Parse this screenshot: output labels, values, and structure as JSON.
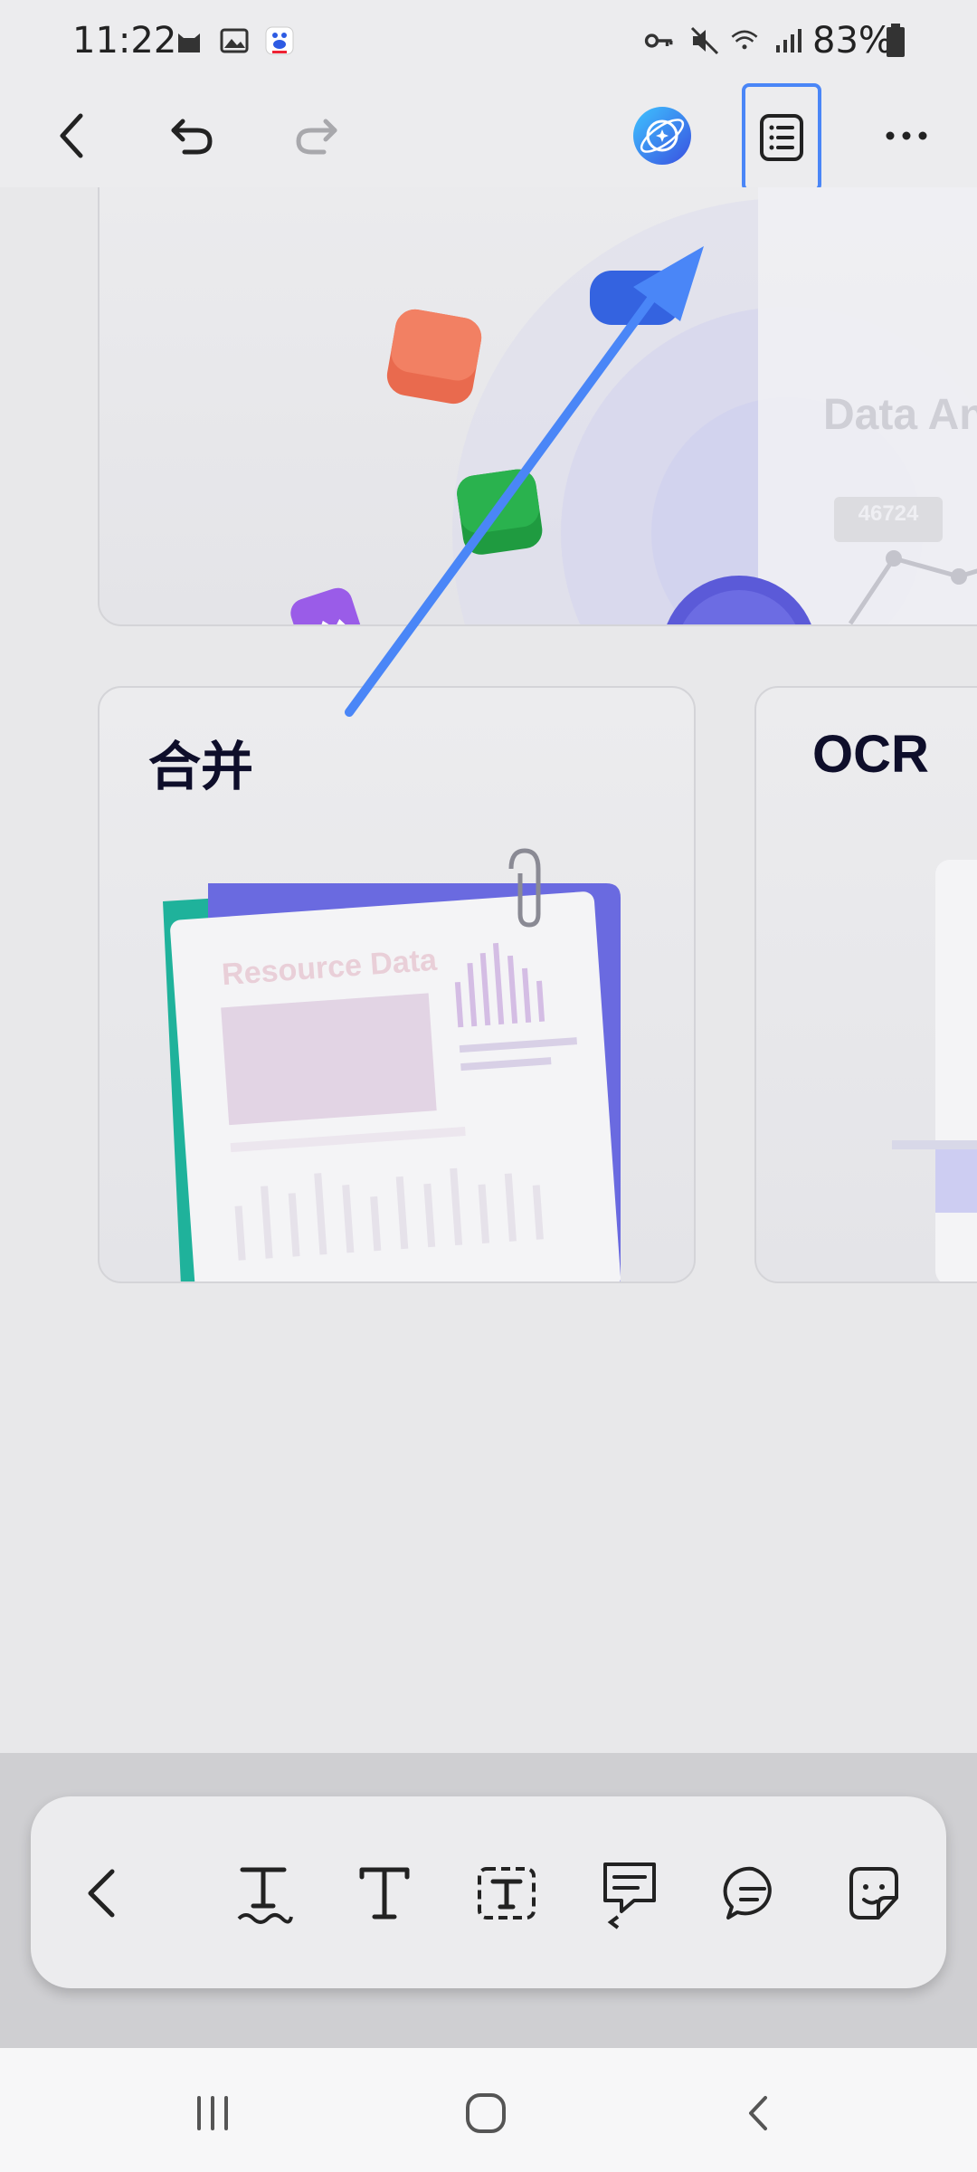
{
  "status_bar": {
    "time": "11:22",
    "battery": "83%"
  },
  "cards": {
    "merge": {
      "title": "合并",
      "illustration_text": "Resource Data"
    },
    "ocr": {
      "title": "OCR"
    },
    "convert": {
      "illustration_title": "Data An",
      "illustration_value": "46724"
    }
  },
  "colors": {
    "accent": "#4a86f7",
    "arrow": "#4a86f7",
    "title_text": "#0e0e2a"
  },
  "icons": {
    "toolbar": [
      "back-icon",
      "undo-icon",
      "redo-icon",
      "ai-assistant-icon",
      "outline-icon",
      "more-icon"
    ],
    "annotation": [
      "chevron-left-icon",
      "text-underline-squiggly-icon",
      "text-icon",
      "textbox-icon",
      "note-reply-icon",
      "comment-icon",
      "sticker-icon"
    ],
    "nav": [
      "recents-icon",
      "home-icon",
      "nav-back-icon"
    ]
  }
}
